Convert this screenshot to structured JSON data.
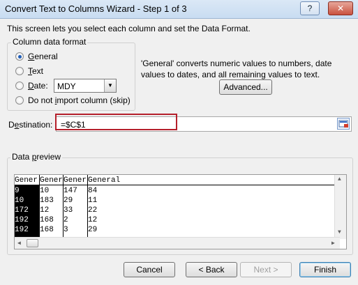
{
  "window": {
    "title": "Convert Text to Columns Wizard - Step 1 of 3",
    "help_label": "?",
    "close_label": "✕"
  },
  "intro_text": "This screen lets you select each column and set the Data Format.",
  "column_format": {
    "legend": "Column data format",
    "options": [
      {
        "label": "General",
        "mnemonic": "G",
        "rest": "eneral",
        "checked": true
      },
      {
        "label": "Text",
        "mnemonic": "T",
        "rest": "ext",
        "checked": false
      },
      {
        "label": "Date:",
        "mnemonic": "D",
        "rest": "ate:",
        "checked": false
      },
      {
        "label": "Do not import column (skip)",
        "prefix": "Do not ",
        "mnemonic": "i",
        "rest": "mport column (skip)",
        "checked": false
      }
    ],
    "date_format": "MDY"
  },
  "description": "'General' converts numeric values to numbers, date values to dates, and all remaining values to text.",
  "advanced_button": "Advanced...",
  "destination": {
    "label_prefix": "D",
    "label_mnemonic": "e",
    "label_rest": "stination:",
    "value": "=$C$1"
  },
  "preview": {
    "legend_prefix": "Data ",
    "legend_mnemonic": "p",
    "legend_rest": "review",
    "headers": [
      "Gener",
      "Gener",
      "Gener",
      "General"
    ],
    "rows": [
      [
        "9",
        "10",
        "147",
        "84"
      ],
      [
        "10",
        "183",
        "29",
        "11"
      ],
      [
        "172",
        "12",
        "33",
        "22"
      ],
      [
        "192",
        "168",
        "2",
        "12"
      ],
      [
        "192",
        "168",
        "3",
        "29"
      ]
    ]
  },
  "footer": {
    "cancel": "Cancel",
    "back": "< Back",
    "next": "Next >",
    "finish": "Finish"
  }
}
